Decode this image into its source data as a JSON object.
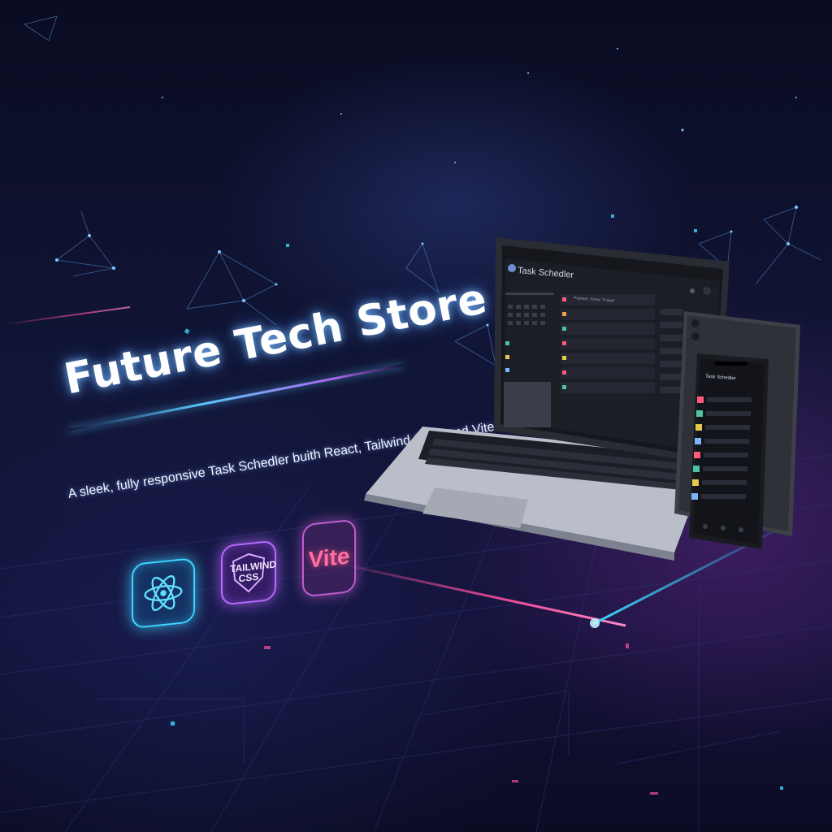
{
  "hero": {
    "title": "Future Tech Store",
    "subtitle": "A sleek, fully responsive Task Schedler buith React, Tailwind CSS, and Vite"
  },
  "tech_badges": [
    {
      "name": "react",
      "label": "",
      "icon": "atom-icon",
      "color": "#3bd6ff"
    },
    {
      "name": "tailwind",
      "label": "TAILWIND CSS",
      "icon": "shield-icon",
      "color": "#b56cff"
    },
    {
      "name": "vite",
      "label": "Vite",
      "icon": "",
      "color": "#ff6fa0"
    }
  ],
  "laptop": {
    "app_title": "Task Schedler",
    "first_task": "Pranner, Finna \"Freed\""
  },
  "phone": {
    "app_title": "Task Schedler"
  },
  "colors": {
    "accent_cyan": "#3bd6ff",
    "accent_purple": "#b56cff",
    "accent_pink": "#ff4fa0",
    "background": "#0b0d26"
  }
}
